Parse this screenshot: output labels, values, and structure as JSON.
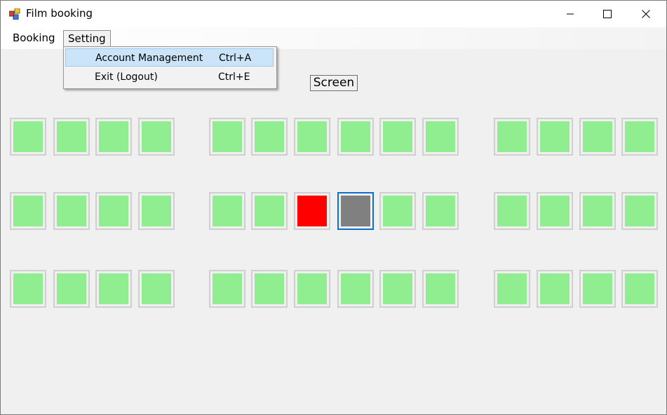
{
  "window": {
    "title": "Film booking"
  },
  "menubar": {
    "items": [
      {
        "label": "Booking"
      },
      {
        "label": "Setting"
      }
    ]
  },
  "dropdown": {
    "items": [
      {
        "label": "Account Management",
        "shortcut": "Ctrl+A"
      },
      {
        "label": "Exit (Logout)",
        "shortcut": "Ctrl+E"
      }
    ]
  },
  "screen": {
    "label": "Screen"
  },
  "colors": {
    "available": "#90ee90",
    "booked": "#ff0000",
    "selected": "#808080",
    "focus": "#0a6fd0"
  },
  "seating": {
    "rows": [
      {
        "seats": [
          "available",
          "available",
          "available",
          "available",
          "available",
          "available",
          "available",
          "available",
          "available",
          "available",
          "available",
          "available",
          "available",
          "available"
        ]
      },
      {
        "seats": [
          "available",
          "available",
          "available",
          "available",
          "available",
          "available",
          "booked",
          "selected",
          "available",
          "available",
          "available",
          "available",
          "available",
          "available"
        ]
      },
      {
        "seats": [
          "available",
          "available",
          "available",
          "available",
          "available",
          "available",
          "available",
          "available",
          "available",
          "available",
          "available",
          "available",
          "available",
          "available"
        ]
      }
    ],
    "focused_seat": {
      "row": 1,
      "index": 7
    }
  }
}
